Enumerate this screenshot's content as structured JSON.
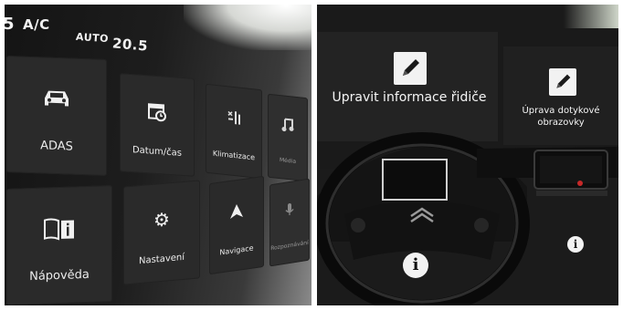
{
  "left_screen": {
    "status": {
      "partial_num": "5",
      "ac": "A/C",
      "auto": "AUTO",
      "temp": "20.5"
    },
    "tiles": [
      {
        "id": "adas",
        "label": "ADAS",
        "icon": "car-icon"
      },
      {
        "id": "date",
        "label": "Datum/čas",
        "icon": "calendar-clock-icon"
      },
      {
        "id": "clim",
        "label": "Klimatizace",
        "icon": "climate-sliders-icon"
      },
      {
        "id": "media",
        "label": "Média",
        "icon": "music-note-icon"
      },
      {
        "id": "help",
        "label": "Nápověda",
        "icon": "book-info-icon"
      },
      {
        "id": "sett",
        "label": "Nastavení",
        "icon": "gear-icon"
      },
      {
        "id": "nav",
        "label": "Navigace",
        "icon": "navigation-arrow-icon"
      },
      {
        "id": "voice",
        "label": "Rozpoznávání",
        "icon": "microphone-icon"
      }
    ]
  },
  "right_screen": {
    "driver_info_label": "Upravit informace řidiče",
    "touchscreen_label": "Úprava dotykové obrazovky",
    "info_symbol": "i"
  }
}
